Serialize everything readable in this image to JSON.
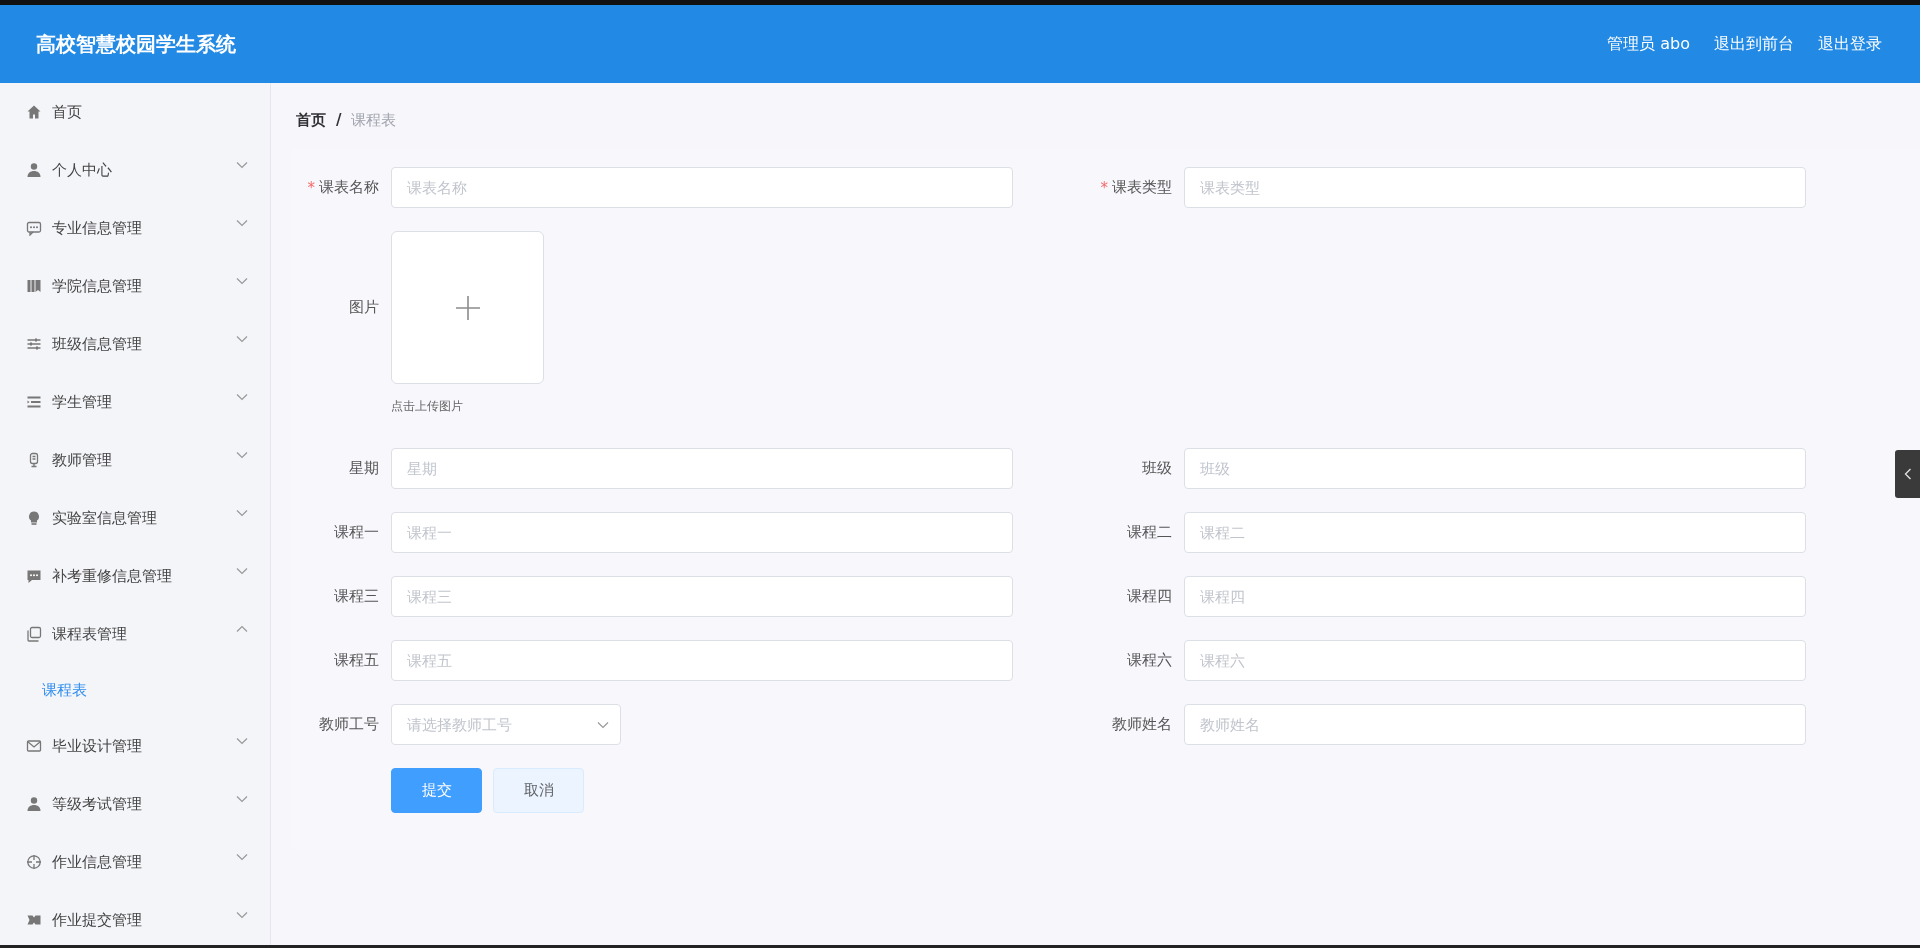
{
  "header": {
    "title": "高校智慧校园学生系统",
    "user": "管理员 abo",
    "links": [
      "退出到前台",
      "退出登录"
    ]
  },
  "sidebar": {
    "items": [
      {
        "label": "首页",
        "kind": "link",
        "selected": false
      },
      {
        "label": "个人中心",
        "kind": "menu",
        "expanded": false,
        "selected": false
      },
      {
        "label": "专业信息管理",
        "kind": "menu",
        "expanded": false,
        "selected": false
      },
      {
        "label": "学院信息管理",
        "kind": "menu",
        "expanded": false,
        "selected": false
      },
      {
        "label": "班级信息管理",
        "kind": "menu",
        "expanded": false,
        "selected": false
      },
      {
        "label": "学生管理",
        "kind": "menu",
        "expanded": false,
        "selected": false
      },
      {
        "label": "教师管理",
        "kind": "menu",
        "expanded": false,
        "selected": false
      },
      {
        "label": "实验室信息管理",
        "kind": "menu",
        "expanded": false,
        "selected": false
      },
      {
        "label": "补考重修信息管理",
        "kind": "menu",
        "expanded": false,
        "selected": false
      },
      {
        "label": "课程表管理",
        "kind": "menu",
        "expanded": true,
        "selected": false,
        "children": [
          {
            "label": "课程表",
            "selected": true
          }
        ]
      },
      {
        "label": "毕业设计管理",
        "kind": "menu",
        "expanded": false,
        "selected": false
      },
      {
        "label": "等级考试管理",
        "kind": "menu",
        "expanded": false,
        "selected": false
      },
      {
        "label": "作业信息管理",
        "kind": "menu",
        "expanded": false,
        "selected": false
      },
      {
        "label": "作业提交管理",
        "kind": "menu",
        "expanded": false,
        "selected": false
      }
    ]
  },
  "breadcrumb": {
    "separator": "/",
    "items": [
      {
        "label": "首页",
        "current": false
      },
      {
        "label": "课程表",
        "current": true
      }
    ]
  },
  "form": {
    "rows": [
      {
        "fields": [
          {
            "kind": "input",
            "label": "课表名称",
            "placeholder": "课表名称",
            "required_mark": "*"
          },
          {
            "kind": "input",
            "label": "课表类型",
            "placeholder": "课表类型",
            "required_mark": "*"
          }
        ]
      },
      {
        "fields": [
          {
            "kind": "upload",
            "label": "图片",
            "hint": "点击上传图片"
          }
        ]
      },
      {
        "fields": [
          {
            "kind": "input",
            "label": "星期",
            "placeholder": "星期"
          },
          {
            "kind": "input",
            "label": "班级",
            "placeholder": "班级"
          }
        ]
      },
      {
        "fields": [
          {
            "kind": "input",
            "label": "课程一",
            "placeholder": "课程一"
          },
          {
            "kind": "input",
            "label": "课程二",
            "placeholder": "课程二"
          }
        ]
      },
      {
        "fields": [
          {
            "kind": "input",
            "label": "课程三",
            "placeholder": "课程三"
          },
          {
            "kind": "input",
            "label": "课程四",
            "placeholder": "课程四"
          }
        ]
      },
      {
        "fields": [
          {
            "kind": "input",
            "label": "课程五",
            "placeholder": "课程五"
          },
          {
            "kind": "input",
            "label": "课程六",
            "placeholder": "课程六"
          }
        ]
      },
      {
        "fields": [
          {
            "kind": "select",
            "label": "教师工号",
            "placeholder": "请选择教师工号"
          },
          {
            "kind": "input",
            "label": "教师姓名",
            "placeholder": "教师姓名"
          }
        ]
      }
    ],
    "buttons": [
      {
        "label": "提交",
        "kind": "primary"
      },
      {
        "label": "取消",
        "kind": "default"
      }
    ]
  }
}
